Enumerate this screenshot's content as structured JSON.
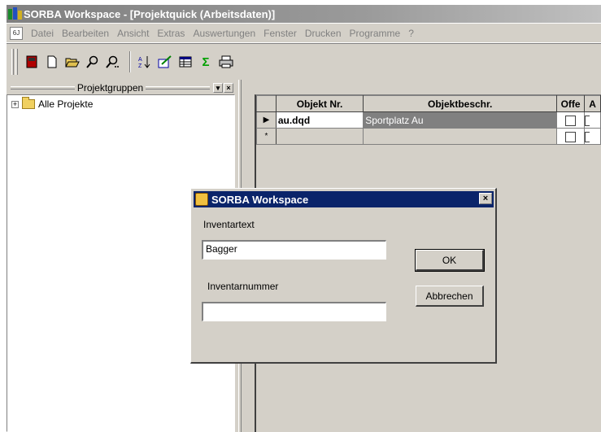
{
  "window": {
    "title": "SORBA Workspace - [Projektquick (Arbeitsdaten)]"
  },
  "menu": {
    "items": [
      "Datei",
      "Bearbeiten",
      "Ansicht",
      "Extras",
      "Auswertungen",
      "Fenster",
      "Drucken",
      "Programme",
      "?"
    ]
  },
  "toolbar": {
    "buttons": [
      "exit-icon",
      "new-document-icon",
      "open-folder-icon",
      "search-icon",
      "search-next-icon",
      "sort-ascending-icon",
      "edit-icon",
      "grid-icon",
      "sum-icon",
      "print-icon"
    ]
  },
  "left_panel": {
    "title": "Projektgruppen",
    "tree": [
      {
        "label": "Alle Projekte",
        "expander": "+"
      }
    ]
  },
  "grid": {
    "columns": [
      "Objekt Nr.",
      "Objektbeschr.",
      "Offe",
      "A"
    ],
    "rows": [
      {
        "row_marker": "▶",
        "objekt_nr": "au.dqd",
        "objektbeschr": "Sportplatz Au"
      },
      {
        "row_marker": "*",
        "objekt_nr": "",
        "objektbeschr": ""
      }
    ]
  },
  "dialog": {
    "title": "SORBA Workspace",
    "close_label": "×",
    "label1": "Inventartext",
    "input1_value": "Bagger",
    "label2": "Inventarnummer",
    "input2_value": "",
    "ok_label": "OK",
    "cancel_label": "Abbrechen"
  },
  "colors": {
    "title_active": "#0a246a",
    "face": "#d4d0c8",
    "grid_selected": "#808080"
  }
}
